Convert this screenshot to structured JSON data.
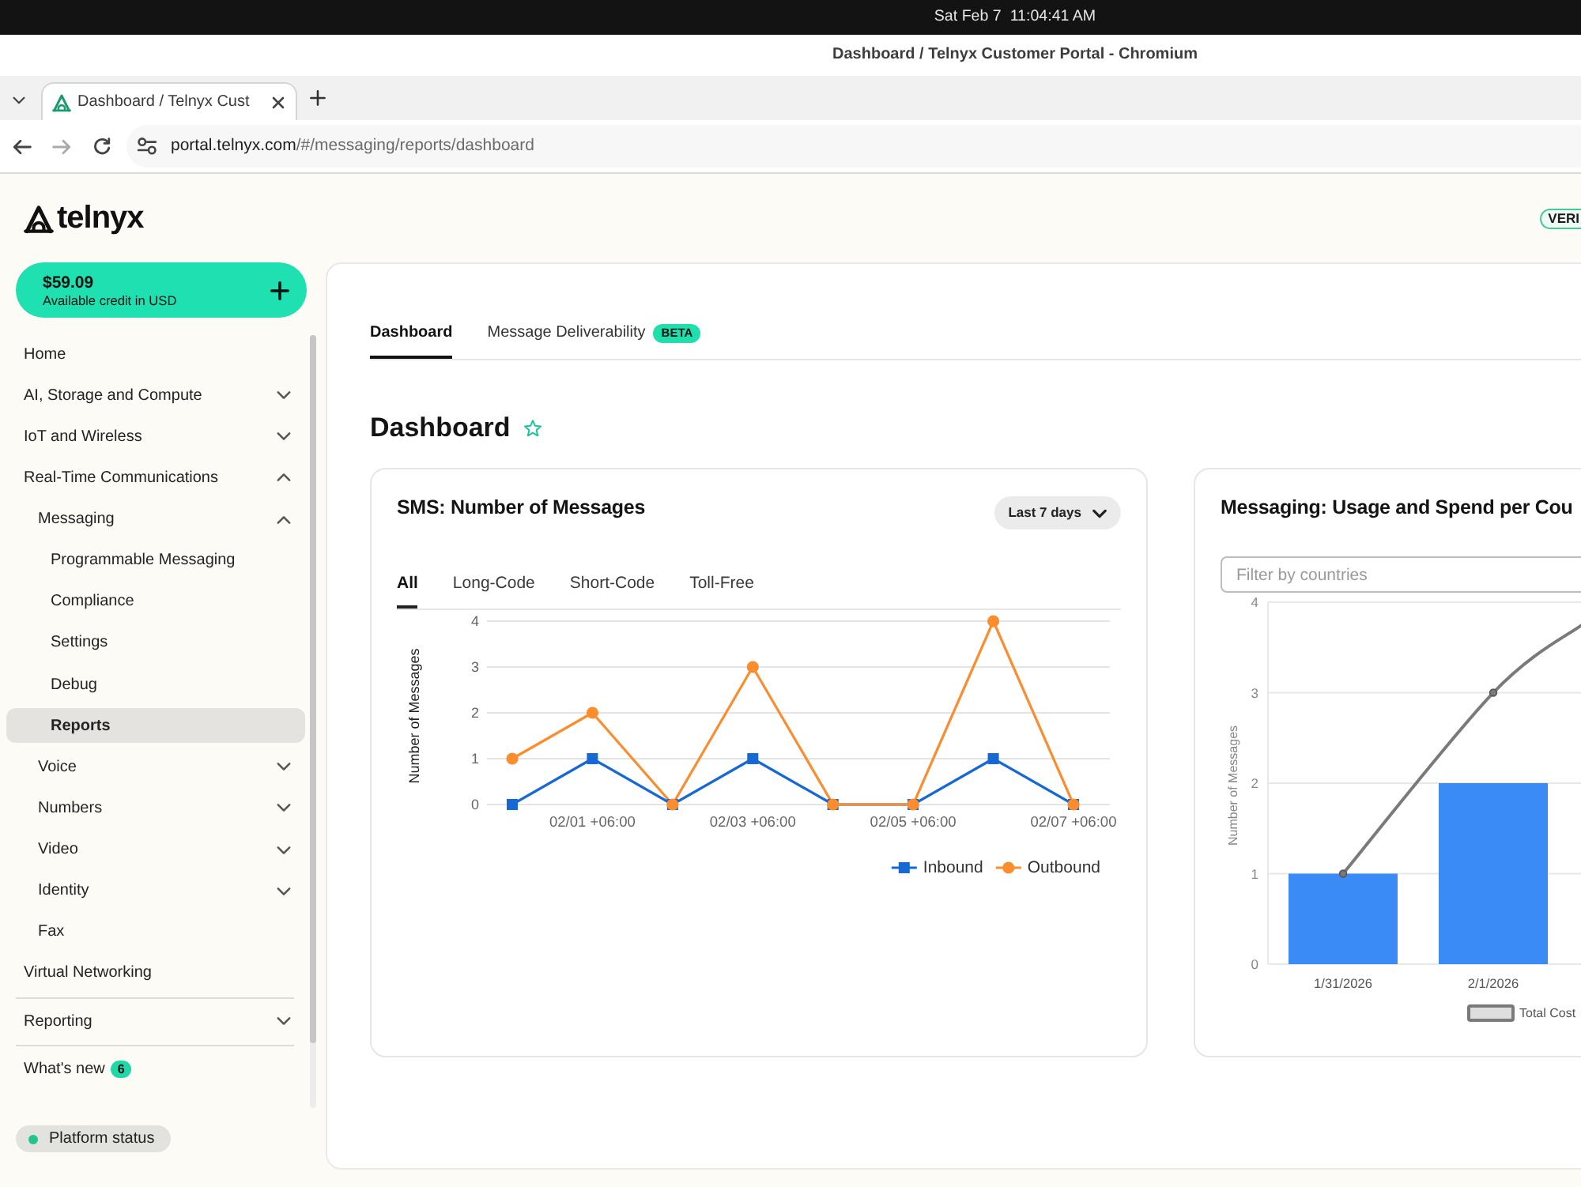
{
  "os_bar": {
    "clock": "Sat Feb 7  11:04:41 AM"
  },
  "window": {
    "title": "Dashboard / Telnyx Customer Portal - Chromium"
  },
  "browser": {
    "tabs": [
      {
        "title": "Dashboard / Telnyx Cust",
        "selected": true
      }
    ],
    "url": {
      "host": "portal.telnyx.com",
      "path": "/#/messaging/reports/dashboard"
    }
  },
  "header": {
    "logo": "telnyx",
    "badge": "VERI"
  },
  "credit": {
    "amount": "$59.09",
    "label": "Available credit in USD"
  },
  "sidebar": {
    "groups": [
      {
        "items": [
          {
            "label": "Home",
            "selected": false
          },
          {
            "label": "AI, Storage and Compute",
            "selected": false,
            "expanded": false
          },
          {
            "label": "IoT and Wireless",
            "selected": false,
            "expanded": false
          },
          {
            "label": "Real-Time Communications",
            "selected": false,
            "expanded": true,
            "children": [
              {
                "label": "Messaging",
                "selected": false,
                "expanded": true,
                "children": [
                  {
                    "label": "Programmable Messaging",
                    "selected": false
                  },
                  {
                    "label": "Compliance",
                    "selected": false
                  },
                  {
                    "label": "Settings",
                    "selected": false
                  },
                  {
                    "label": "Debug",
                    "selected": false
                  },
                  {
                    "label": "Reports",
                    "selected": true
                  }
                ]
              },
              {
                "label": "Voice",
                "selected": false,
                "expanded": false
              },
              {
                "label": "Numbers",
                "selected": false,
                "expanded": false
              },
              {
                "label": "Video",
                "selected": false,
                "expanded": false
              },
              {
                "label": "Identity",
                "selected": false,
                "expanded": false
              },
              {
                "label": "Fax",
                "selected": false
              }
            ]
          },
          {
            "label": "Virtual Networking",
            "selected": false
          }
        ]
      },
      {
        "items": [
          {
            "label": "Reporting",
            "selected": false,
            "expanded": false
          }
        ]
      },
      {
        "items": [
          {
            "label": "What's new",
            "selected": false,
            "badge": "6"
          }
        ]
      }
    ]
  },
  "status": {
    "label": "Platform status"
  },
  "main": {
    "tabs": [
      {
        "label": "Dashboard",
        "selected": true
      },
      {
        "label": "Message Deliverability",
        "selected": false,
        "badge": "BETA"
      }
    ],
    "heading": "Dashboard",
    "favorite": false,
    "cards": [
      {
        "title": "SMS: Number of Messages",
        "range": "Last 7 days",
        "tabs": [
          {
            "label": "All",
            "selected": true
          },
          {
            "label": "Long-Code",
            "selected": false
          },
          {
            "label": "Short-Code",
            "selected": false
          },
          {
            "label": "Toll-Free",
            "selected": false
          }
        ],
        "chart_data": {
          "type": "line",
          "ylabel": "Number of Messages",
          "categories": [
            null,
            "02/01 +06:00",
            null,
            "02/03 +06:00",
            null,
            "02/05 +06:00",
            null,
            "02/07 +06:00"
          ],
          "yticks": [
            0,
            1,
            2,
            3,
            4
          ],
          "ylim": [
            0,
            4
          ],
          "grid": true,
          "legend": "bottom",
          "series": [
            {
              "name": "Inbound",
              "color": "#1668d4",
              "marker": "square",
              "values": [
                0,
                1,
                0,
                1,
                0,
                0,
                1,
                0
              ]
            },
            {
              "name": "Outbound",
              "color": "#fb8d2e",
              "marker": "circle",
              "values": [
                1,
                2,
                0,
                3,
                0,
                0,
                4,
                0
              ]
            }
          ]
        }
      },
      {
        "title": "Messaging: Usage and Spend per Cou",
        "filter": {
          "placeholder": "Filter by countries"
        },
        "chart_data": {
          "type": "bar",
          "ylabel": "Number of Messages",
          "categories": [
            "1/31/2026",
            "2/1/2026"
          ],
          "yticks": [
            0,
            1,
            2,
            3,
            4
          ],
          "ylim": [
            0,
            4
          ],
          "grid": true,
          "legend": "bottom",
          "series": [
            {
              "type": "bar",
              "color": "#3b8bf6",
              "values": [
                1,
                2
              ]
            },
            {
              "name": "Total Cost",
              "type": "line",
              "color": "#7a7a7a",
              "marker": "dot",
              "values": [
                1,
                3
              ]
            }
          ]
        }
      }
    ]
  }
}
